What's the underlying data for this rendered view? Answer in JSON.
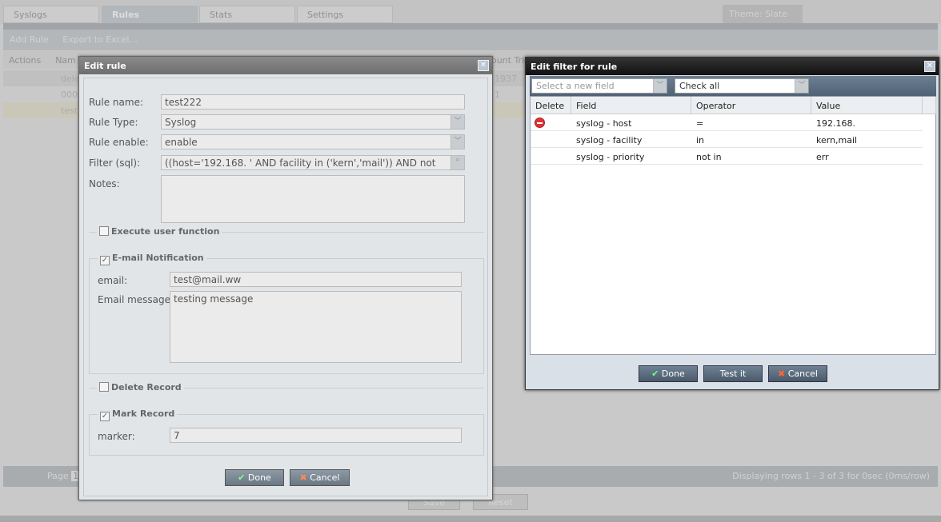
{
  "tabs": [
    "Syslogs",
    "Rules",
    "Stats",
    "Settings"
  ],
  "theme": "Theme: Slate",
  "toolbar": {
    "add": "Add Rule",
    "export": "Export to Excel..."
  },
  "grid": {
    "actions": "Actions",
    "name": "Nam",
    "count": "ount Trig",
    "rows": [
      {
        "name": "delet",
        "count": "1937"
      },
      {
        "name": "0000",
        "count": "1"
      },
      {
        "name": "test2",
        "count": ""
      }
    ]
  },
  "pager": {
    "page": "Page",
    "page_value": "1",
    "status": "Displaying rows 1 - 3 of 3 for 0sec (0ms/row)"
  },
  "bottom": {
    "save": "Save",
    "reset": "Reset"
  },
  "edit_rule": {
    "title": "Edit rule",
    "rule_name_label": "Rule name:",
    "rule_name": "test222",
    "rule_type_label": "Rule Type:",
    "rule_type": "Syslog",
    "enable_label": "Rule enable:",
    "enable": "enable",
    "filter_label": "Filter (sql):",
    "filter": "((host='192.168.    ' AND  facility in ('kern','mail')) AND not",
    "notes_label": "Notes:",
    "notes": "",
    "exec_label": "Execute user function",
    "email_section": "E-mail Notification",
    "email_label": "email:",
    "email": "test@mail.ww",
    "msg_label": "Email message:",
    "msg": "testing message",
    "delete_label": "Delete Record",
    "mark_label": "Mark Record",
    "marker_label": "marker:",
    "marker": "7",
    "done": "Done",
    "cancel": "Cancel"
  },
  "filter": {
    "title": "Edit filter for rule",
    "select_placeholder": "Select a new field",
    "check": "Check all",
    "headers": [
      "Delete",
      "Field",
      "Operator",
      "Value"
    ],
    "rows": [
      {
        "field": "syslog - host",
        "op": "=",
        "value": "192.168.    ",
        "del": true
      },
      {
        "field": "syslog - facility",
        "op": "in",
        "value": "kern,mail"
      },
      {
        "field": "syslog - priority",
        "op": "not in",
        "value": "err"
      }
    ],
    "done": "Done",
    "test": "Test it",
    "cancel": "Cancel"
  }
}
